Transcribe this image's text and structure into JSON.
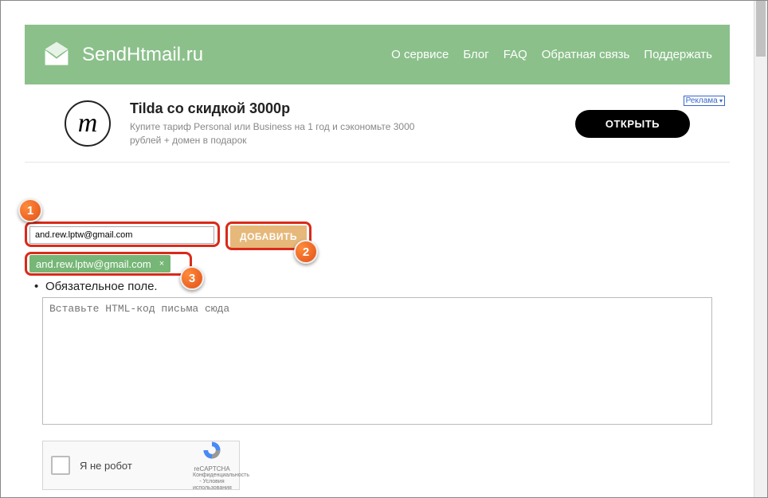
{
  "header": {
    "site_title": "SendHtmail.ru",
    "nav": {
      "about": "О сервисе",
      "blog": "Блог",
      "faq": "FAQ",
      "feedback": "Обратная связь",
      "support": "Поддержать"
    }
  },
  "ad": {
    "badge": "Реклама",
    "logo_letter": "т",
    "title": "Tilda со скидкой 3000р",
    "subtitle": "Купите тариф Personal или Business на 1 год и сэкономьте 3000 рублей + домен в подарок",
    "cta": "ОТКРЫТЬ"
  },
  "form": {
    "email_value": "and.rew.lptw@gmail.com",
    "add_label": "ДОБАВИТЬ",
    "chip_email": "and.rew.lptw@gmail.com",
    "chip_close": "×",
    "required_note": "Обязательное поле.",
    "code_placeholder": "Вставьте HTML-код письма сюда"
  },
  "captcha": {
    "label": "Я не робот",
    "brand": "reCAPTCHA",
    "terms": "Конфиденциальность - Условия использования"
  },
  "markers": {
    "m1": "1",
    "m2": "2",
    "m3": "3"
  }
}
